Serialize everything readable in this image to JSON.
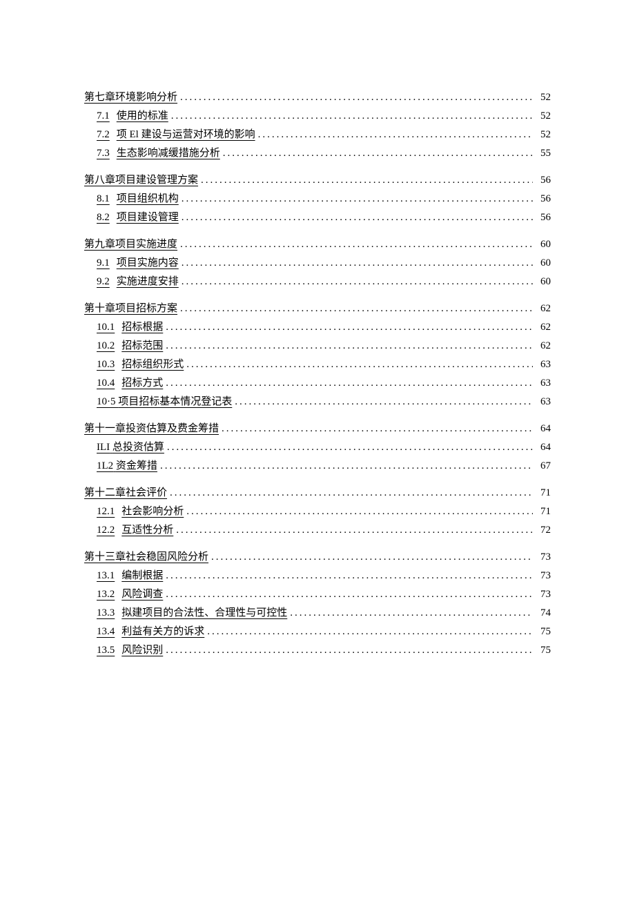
{
  "toc": [
    {
      "type": "chapter",
      "label": "第七章环境影响分析",
      "page": "52"
    },
    {
      "type": "sub",
      "num": "7.1",
      "title": "使用的标准",
      "page": "52"
    },
    {
      "type": "sub",
      "num": "7.2",
      "title": "项 El 建设与运营对环境的影响",
      "page": "52"
    },
    {
      "type": "sub",
      "num": "7.3",
      "title": "生态影响减缓措施分析",
      "page": "55"
    },
    {
      "type": "chapter",
      "label": "第八章项目建设管理方案",
      "page": "56"
    },
    {
      "type": "sub",
      "num": "8.1",
      "title": "项目组织机构",
      "page": "56"
    },
    {
      "type": "sub",
      "num": "8.2",
      "title": "项目建设管理",
      "page": "56"
    },
    {
      "type": "chapter",
      "label": "第九章项目实施进度",
      "page": "60"
    },
    {
      "type": "sub",
      "num": "9.1",
      "title": "项目实施内容",
      "page": "60"
    },
    {
      "type": "sub",
      "num": "9.2",
      "title": "实施进度安排",
      "page": "60"
    },
    {
      "type": "chapter",
      "label": "第十章项目招标方案",
      "page": "62"
    },
    {
      "type": "sub",
      "num": "10.1",
      "title": "招标根据",
      "page": "62"
    },
    {
      "type": "sub",
      "num": "10.2",
      "title": "招标范围",
      "page": "62"
    },
    {
      "type": "sub",
      "num": "10.3",
      "title": "招标组织形式",
      "page": "63"
    },
    {
      "type": "sub",
      "num": "10.4",
      "title": "招标方式",
      "page": "63"
    },
    {
      "type": "sub",
      "num": "10·5",
      "title": "项目招标基本情况登记表",
      "page": "63",
      "joined": true
    },
    {
      "type": "chapter",
      "label": "第十一章投资估算及费金筹措",
      "page": "64"
    },
    {
      "type": "sub",
      "num": "ILI",
      "title": "总投资估算",
      "page": "64",
      "joined": true
    },
    {
      "type": "sub",
      "num": "1L2",
      "title": "资金筹措",
      "page": "67",
      "joined": true
    },
    {
      "type": "chapter",
      "label": "第十二章社会评价",
      "page": "71"
    },
    {
      "type": "sub",
      "num": "12.1",
      "title": "社会影响分析",
      "page": "71"
    },
    {
      "type": "sub",
      "num": "12.2",
      "title": "互适性分析",
      "page": "72"
    },
    {
      "type": "chapter",
      "label": "第十三章社会稳固风险分析",
      "page": "73"
    },
    {
      "type": "sub",
      "num": "13.1",
      "title": "编制根据",
      "page": "73"
    },
    {
      "type": "sub",
      "num": "13.2",
      "title": "风险调查",
      "page": "73"
    },
    {
      "type": "sub",
      "num": "13.3",
      "title": "拟建项目的合法性、合理性与可控性",
      "page": "74"
    },
    {
      "type": "sub",
      "num": "13.4",
      "title": "利益有关方的诉求",
      "page": "75"
    },
    {
      "type": "sub",
      "num": "13.5",
      "title": "风险识别",
      "page": "75"
    }
  ]
}
